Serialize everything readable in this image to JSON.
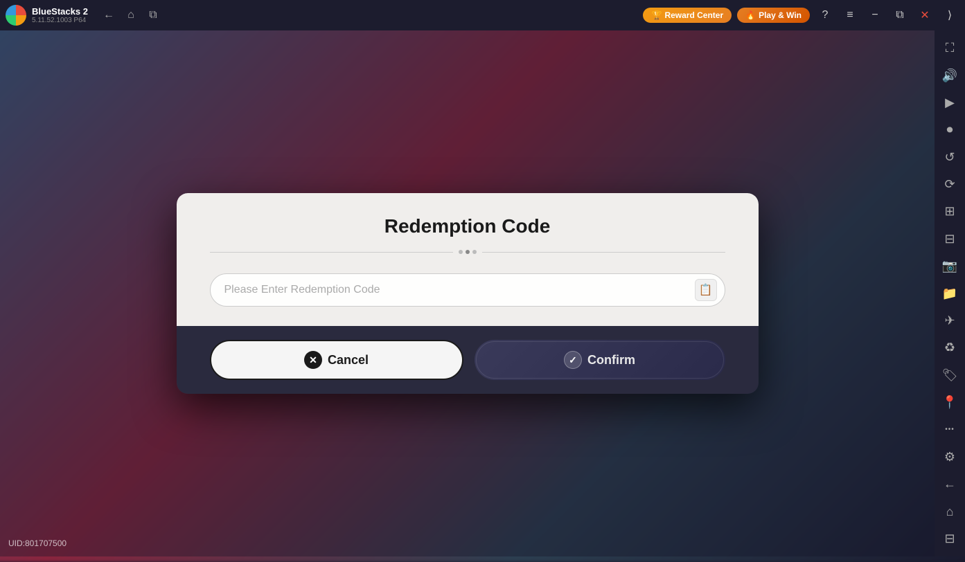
{
  "app": {
    "name": "BlueStacks 2",
    "version": "5.11.52.1003  P64"
  },
  "topbar": {
    "back_label": "←",
    "home_label": "⌂",
    "tabs_label": "⧉",
    "reward_center_label": "Reward Center",
    "play_win_label": "Play & Win",
    "help_label": "?",
    "menu_label": "≡",
    "minimize_label": "−",
    "restore_label": "⧉",
    "close_label": "✕",
    "expand_label": "⟩"
  },
  "sidebar": {
    "icons": [
      {
        "name": "fullscreen-icon",
        "symbol": "⛶"
      },
      {
        "name": "volume-icon",
        "symbol": "🔊"
      },
      {
        "name": "video-icon",
        "symbol": "▶"
      },
      {
        "name": "camera-icon",
        "symbol": "📷"
      },
      {
        "name": "rotate-icon",
        "symbol": "↺"
      },
      {
        "name": "refresh-icon",
        "symbol": "⟳"
      },
      {
        "name": "stack-icon",
        "symbol": "⊞"
      },
      {
        "name": "apps-icon",
        "symbol": "⊟"
      },
      {
        "name": "screenshot-icon",
        "symbol": "📸"
      },
      {
        "name": "folder-icon",
        "symbol": "📁"
      },
      {
        "name": "plane-icon",
        "symbol": "✈"
      },
      {
        "name": "eco-icon",
        "symbol": "♻"
      },
      {
        "name": "tag-icon",
        "symbol": "🏷"
      },
      {
        "name": "location-icon",
        "symbol": "📍"
      },
      {
        "name": "more-icon",
        "symbol": "•••"
      },
      {
        "name": "settings-icon",
        "symbol": "⚙"
      },
      {
        "name": "back-icon",
        "symbol": "←"
      },
      {
        "name": "home-sidebar-icon",
        "symbol": "⌂"
      },
      {
        "name": "layers-icon",
        "symbol": "⊟"
      }
    ]
  },
  "dialog": {
    "title": "Redemption Code",
    "input_placeholder": "Please Enter Redemption Code",
    "cancel_label": "Cancel",
    "confirm_label": "Confirm"
  },
  "footer": {
    "uid_label": "UID:801707500"
  }
}
